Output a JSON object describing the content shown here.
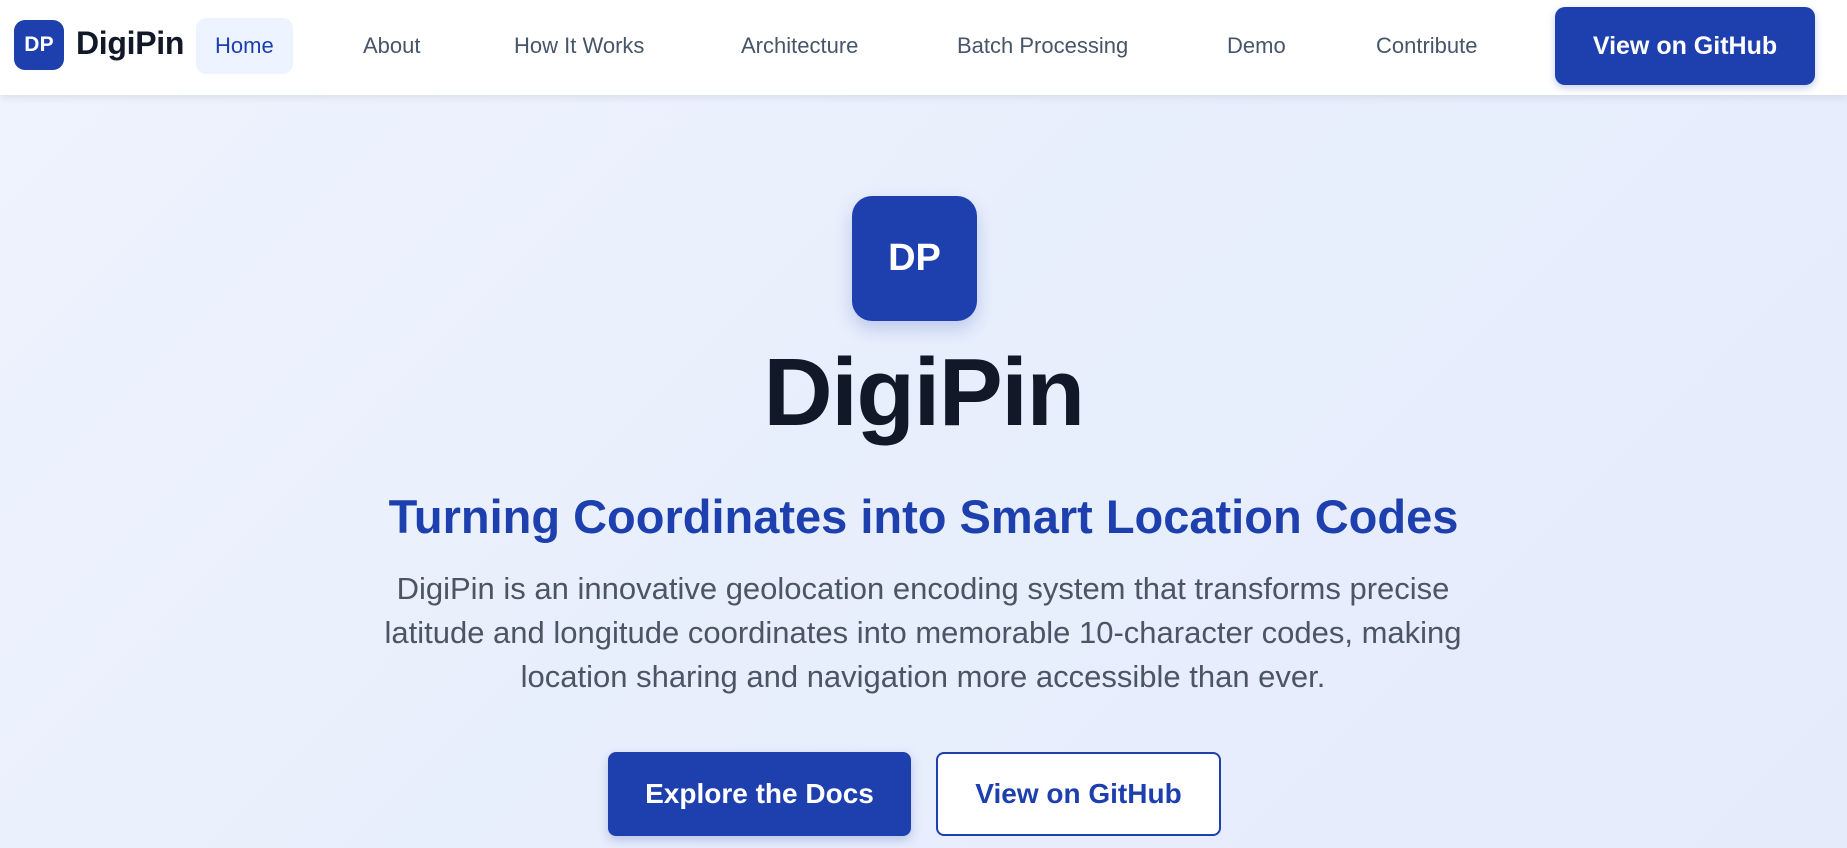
{
  "navbar": {
    "logo_text": "DP",
    "brand_name": "DigiPin",
    "links": [
      {
        "label": "Home",
        "active": true
      },
      {
        "label": "About",
        "active": false
      },
      {
        "label": "How It Works",
        "active": false
      },
      {
        "label": "Architecture",
        "active": false
      },
      {
        "label": "Batch Processing",
        "active": false
      },
      {
        "label": "Demo",
        "active": false
      },
      {
        "label": "Contribute",
        "active": false
      }
    ],
    "cta_label": "View on GitHub"
  },
  "hero": {
    "logo_text": "DP",
    "title": "DigiPin",
    "subtitle": "Turning Coordinates into Smart Location Codes",
    "description_lines": [
      "DigiPin is an innovative geolocation encoding system that transforms precise",
      "latitude and longitude coordinates into memorable 10-character codes, making",
      "location sharing and navigation more accessible than ever."
    ],
    "primary_button": "Explore the Docs",
    "secondary_button": "View on GitHub"
  },
  "colors": {
    "brand": "#1e3fae",
    "heading": "#111827",
    "body_text": "#4b5563",
    "nav_text": "#475569",
    "active_nav_bg": "#eef4ff",
    "hero_bg": "#e9effc"
  }
}
